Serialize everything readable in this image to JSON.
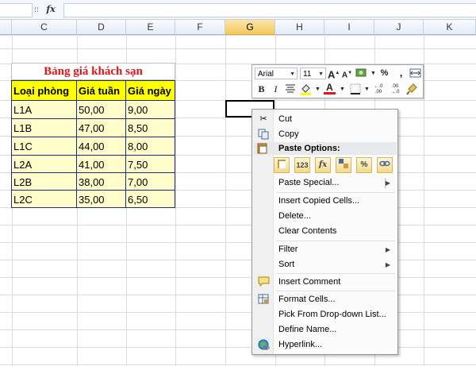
{
  "formula_bar": {
    "fx_label": "fx",
    "value": ""
  },
  "columns": [
    "C",
    "D",
    "E",
    "F",
    "G",
    "H",
    "I",
    "J",
    "K"
  ],
  "selected_column": "G",
  "price_table": {
    "title": "Bảng giá khách sạn",
    "headers": [
      "Loại phòng",
      "Giá tuần",
      "Giá ngày"
    ],
    "rows": [
      [
        "L1A",
        "50,00",
        "9,00"
      ],
      [
        "L1B",
        "47,00",
        "8,50"
      ],
      [
        "L1C",
        "44,00",
        "8,00"
      ],
      [
        "L2A",
        "41,00",
        "7,50"
      ],
      [
        "L2B",
        "38,00",
        "7,00"
      ],
      [
        "L2C",
        "35,00",
        "6,50"
      ]
    ],
    "colors": {
      "title": "#e0141b",
      "header_bg": "#ffff00",
      "body_bg": "#fffecb",
      "border": "#1f2a7a"
    }
  },
  "mini_toolbar": {
    "font_name": "Arial",
    "font_size": "11",
    "grow_font": "A",
    "shrink_font": "A",
    "percent": "%",
    "comma": ",",
    "bold": "B",
    "italic": "I",
    "font_color_label": "A",
    "increase_decimal": "←.0 .00",
    "decrease_decimal": ".00 →.0"
  },
  "context_menu": {
    "cut": "Cut",
    "copy": "Copy",
    "paste_options": "Paste Options:",
    "paste_buttons": [
      "paste",
      "123",
      "fx",
      "transpose",
      "%",
      "link"
    ],
    "paste_special": "Paste Special...",
    "insert_copied_cells": "Insert Copied Cells...",
    "delete": "Delete...",
    "clear_contents": "Clear Contents",
    "filter": "Filter",
    "sort": "Sort",
    "insert_comment": "Insert Comment",
    "format_cells": "Format Cells...",
    "pick_from_list": "Pick From Drop-down List...",
    "define_name": "Define Name...",
    "hyperlink": "Hyperlink..."
  }
}
